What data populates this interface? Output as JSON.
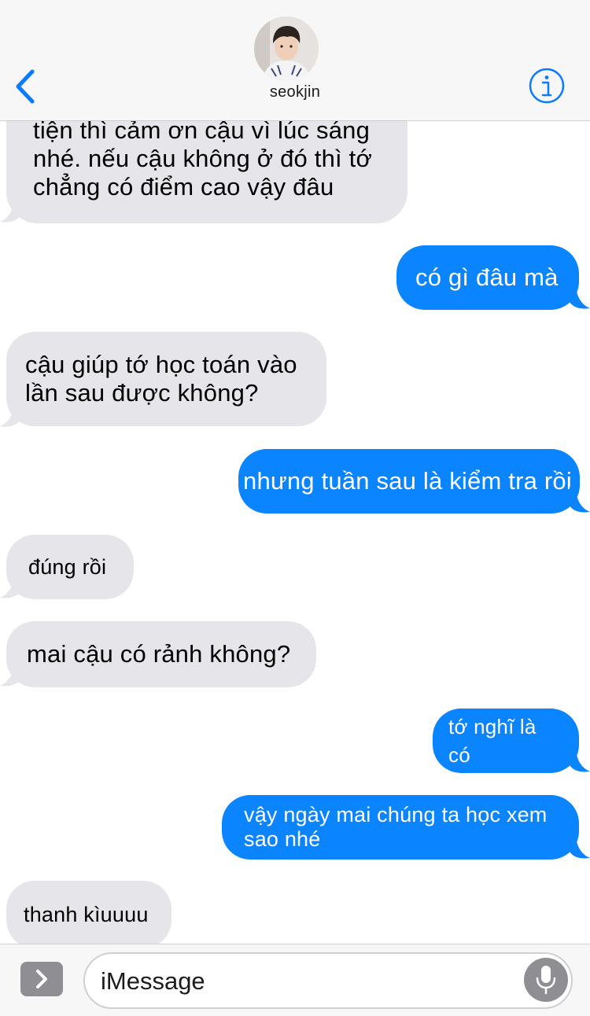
{
  "header": {
    "contact_name": "seokjin",
    "back_icon": "chevron-left-icon",
    "info_icon": "info-icon"
  },
  "messages": [
    {
      "side": "in",
      "text": "tiện thì cảm ơn cậu vì lúc sáng\nnhé. nếu cậu không ở đó thì tớ\nchẳng có điểm cao vậy đâu"
    },
    {
      "side": "out",
      "text": "có gì đâu mà"
    },
    {
      "side": "in",
      "text": "cậu giúp tớ học toán vào\nlần sau được không?"
    },
    {
      "side": "out",
      "text": "nhưng tuần sau là kiểm tra rồi"
    },
    {
      "side": "in",
      "text": "đúng rồi"
    },
    {
      "side": "in",
      "text": "mai cậu có rảnh không?"
    },
    {
      "side": "out",
      "text": "tớ nghĩ là có"
    },
    {
      "side": "out",
      "text": "vậy ngày mai chúng ta học xem\nsao nhé"
    },
    {
      "side": "in",
      "text": "thanh kìuuuu"
    }
  ],
  "input": {
    "placeholder": "iMessage",
    "expand_icon": "chevron-right-icon",
    "mic_icon": "microphone-icon"
  },
  "colors": {
    "outgoing_bubble": "#0a84ff",
    "incoming_bubble": "#e5e5ea",
    "accent": "#0a7aff",
    "bar_background": "#f7f7f7"
  }
}
